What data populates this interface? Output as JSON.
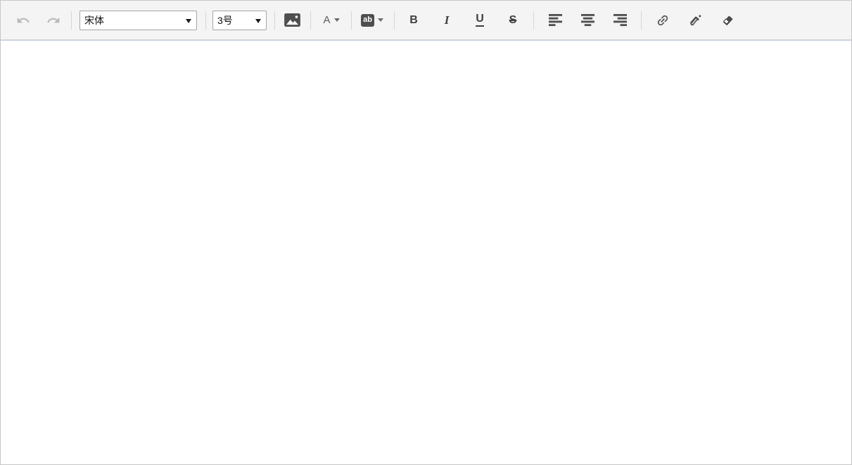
{
  "toolbar": {
    "undo": {
      "icon": "undo-icon"
    },
    "redo": {
      "icon": "redo-icon"
    },
    "font_family": {
      "value": "宋体"
    },
    "font_size": {
      "value": "3号"
    },
    "insert_image": {
      "icon": "image-icon"
    },
    "font_color": {
      "label": "A",
      "icon": "caret-down-icon"
    },
    "highlight": {
      "label": "ab",
      "icon": "caret-down-icon"
    },
    "bold": {
      "label": "B"
    },
    "italic": {
      "label": "I"
    },
    "underline": {
      "label": "U"
    },
    "strikethrough": {
      "label": "S"
    },
    "align_left": {
      "icon": "align-left-icon"
    },
    "align_center": {
      "icon": "align-center-icon"
    },
    "align_right": {
      "icon": "align-right-icon"
    },
    "link": {
      "icon": "link-icon"
    },
    "format_brush": {
      "icon": "brush-icon"
    },
    "eraser": {
      "icon": "eraser-icon"
    },
    "colors": {
      "toolbar_bg": "#f4f4f4",
      "toolbar_bottom_border": "#ccd4dd",
      "outer_border": "#c6c6c6",
      "icon": "#4a4a4a",
      "icon_disabled": "#b9b9b9",
      "badge_bg": "#4f4f4f",
      "divider": "#d6d6d6",
      "select_border": "#a5a5a5"
    }
  },
  "content": {
    "text": ""
  }
}
